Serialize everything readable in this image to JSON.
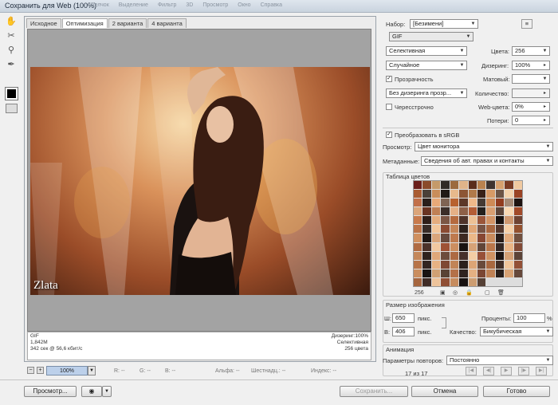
{
  "window": {
    "title": "Сохранить для Web (100%)",
    "menus": [
      "Щелчок",
      "Выделение",
      "Фильтр",
      "3D",
      "Просмотр",
      "Окно",
      "Справка"
    ]
  },
  "tabs": [
    "Исходное",
    "Оптимизация",
    "2 варианта",
    "4 варианта"
  ],
  "tools": {
    "hand": "✋",
    "slice": "✂",
    "zoom": "🔍",
    "eyedropper": "✒"
  },
  "image": {
    "watermark": "Zlata"
  },
  "caption": {
    "format": "GIF",
    "size": "1,842M",
    "speed": "342 сек @ 56,6 кбит/с",
    "dither": "Дизеринг:100%",
    "palette": "Селективная",
    "colors": "256 цвета"
  },
  "statusbar": {
    "zoom": "100%",
    "r": "R: --",
    "g": "G: --",
    "b": "B: --",
    "alpha": "Альфа: --",
    "hex": "Шестнадц.: --",
    "index": "Индекс: --"
  },
  "settings": {
    "preset_label": "Набор:",
    "preset_value": "[Безимени]",
    "format": "GIF",
    "reduction": "Селективная",
    "dither_algo": "Случайное",
    "colors_label": "Цвета:",
    "colors_value": "256",
    "dither_label": "Дизеринг:",
    "dither_value": "100%",
    "transparency_label": "Прозрачность",
    "transparency_checked": true,
    "matte_label": "Матовый:",
    "transparency_dither": "Без дизеринга прозр...",
    "amount_label": "Количество:",
    "interlaced_label": "Чересстрочно",
    "interlaced_checked": false,
    "websnap_label": "Web-цвета:",
    "websnap_value": "0%",
    "lossy_label": "Потери:",
    "lossy_value": "0",
    "srgb_label": "Преобразовать в sRGB",
    "srgb_checked": true,
    "preview_label": "Просмотр:",
    "preview_value": "Цвет монитора",
    "metadata_label": "Метаданные:",
    "metadata_value": "Сведения об авт. правах и контакты"
  },
  "color_table": {
    "title": "Таблица цветов",
    "count": "256",
    "colors": [
      "#6b1f1a",
      "#8a4a2a",
      "#c59a6a",
      "#2f2a26",
      "#9c6a3e",
      "#e0b48a",
      "#5a2d1c",
      "#b9824f",
      "#3d3330",
      "#d5a06f",
      "#7a3b24",
      "#f0c9a0",
      "#a95c32",
      "#4a4038",
      "#c98d5a",
      "#201a17",
      "#e7b98c",
      "#8c5535",
      "#b17a4a",
      "#3a2218",
      "#d89a66",
      "#6d5446",
      "#f3d2ad",
      "#9a4324",
      "#c2704a",
      "#2a1f1b",
      "#e8a978",
      "#7f6454",
      "#b8612f",
      "#5c3728",
      "#f0b98a",
      "#463a33",
      "#cf8a56",
      "#913c20",
      "#a68a76",
      "#1d1311",
      "#dba57a",
      "#6a3422",
      "#c08055",
      "#3b2e29",
      "#e5b086",
      "#8e6048",
      "#b45d35",
      "#24201d",
      "#d99f72",
      "#5e4539",
      "#fad9b4",
      "#a24a2a",
      "#c87a4c",
      "#301f19",
      "#e4ac7e",
      "#7b5645",
      "#b56a3e",
      "#4f332a",
      "#edc195",
      "#9b563a",
      "#d39466",
      "#17100e",
      "#cf9870",
      "#6e4232",
      "#bb7348",
      "#382c27",
      "#f2c69b",
      "#8a4b33",
      "#c58658",
      "#2c211c",
      "#e0a676",
      "#775344",
      "#a9673f",
      "#54372c",
      "#f6d0a8",
      "#94512f",
      "#d0905f",
      "#1f1714",
      "#d9a57b",
      "#674a3e",
      "#be7a4e",
      "#3e2a22",
      "#ebb888",
      "#874733",
      "#c98b5c",
      "#271c18",
      "#e2ab7d",
      "#72503f",
      "#b06b42",
      "#4a3129",
      "#f1c8a0",
      "#9e5236",
      "#cc8e60",
      "#181210",
      "#d6a277",
      "#614538",
      "#ba774b",
      "#352824",
      "#eab586",
      "#824a36",
      "#c4875a",
      "#2e221d",
      "#dfa779",
      "#6c4c3d",
      "#ad6a43",
      "#46302a",
      "#f4cda4",
      "#975038",
      "#ce9262",
      "#1b1412",
      "#d3a075",
      "#5b4337",
      "#b77449",
      "#322521",
      "#e7b283",
      "#7e4834",
      "#c18457",
      "#2b201b",
      "#dca576",
      "#694a3b",
      "#a96840",
      "#432e27",
      "#f0c59c",
      "#935036",
      "#ca8e5f",
      "#191311",
      "#d0a073",
      "#584236",
      "#b47148",
      "#2f231f",
      "#e4b082",
      "#7a4633",
      "#be8155",
      "#281e1a",
      "#d8a274",
      "#66483a",
      "#a6663f",
      "#402c26",
      "#eec39a",
      "#8f4e35",
      "#c78c5e",
      "#171110",
      "#cd9d71",
      "#554035"
    ]
  },
  "image_size": {
    "title": "Размер изображения",
    "w_label": "Ш:",
    "w_value": "650",
    "h_label": "В:",
    "h_value": "406",
    "unit": "пикс.",
    "percent_label": "Проценты:",
    "percent_value": "100",
    "percent_unit": "%",
    "quality_label": "Качество:",
    "quality_value": "Бикубическая"
  },
  "animation": {
    "title": "Анимация",
    "loop_label": "Параметры повторов:",
    "loop_value": "Постоянно",
    "frame": "17 из 17"
  },
  "buttons": {
    "preview": "Просмотр...",
    "save": "Сохранить...",
    "cancel": "Отмена",
    "done": "Готово"
  }
}
